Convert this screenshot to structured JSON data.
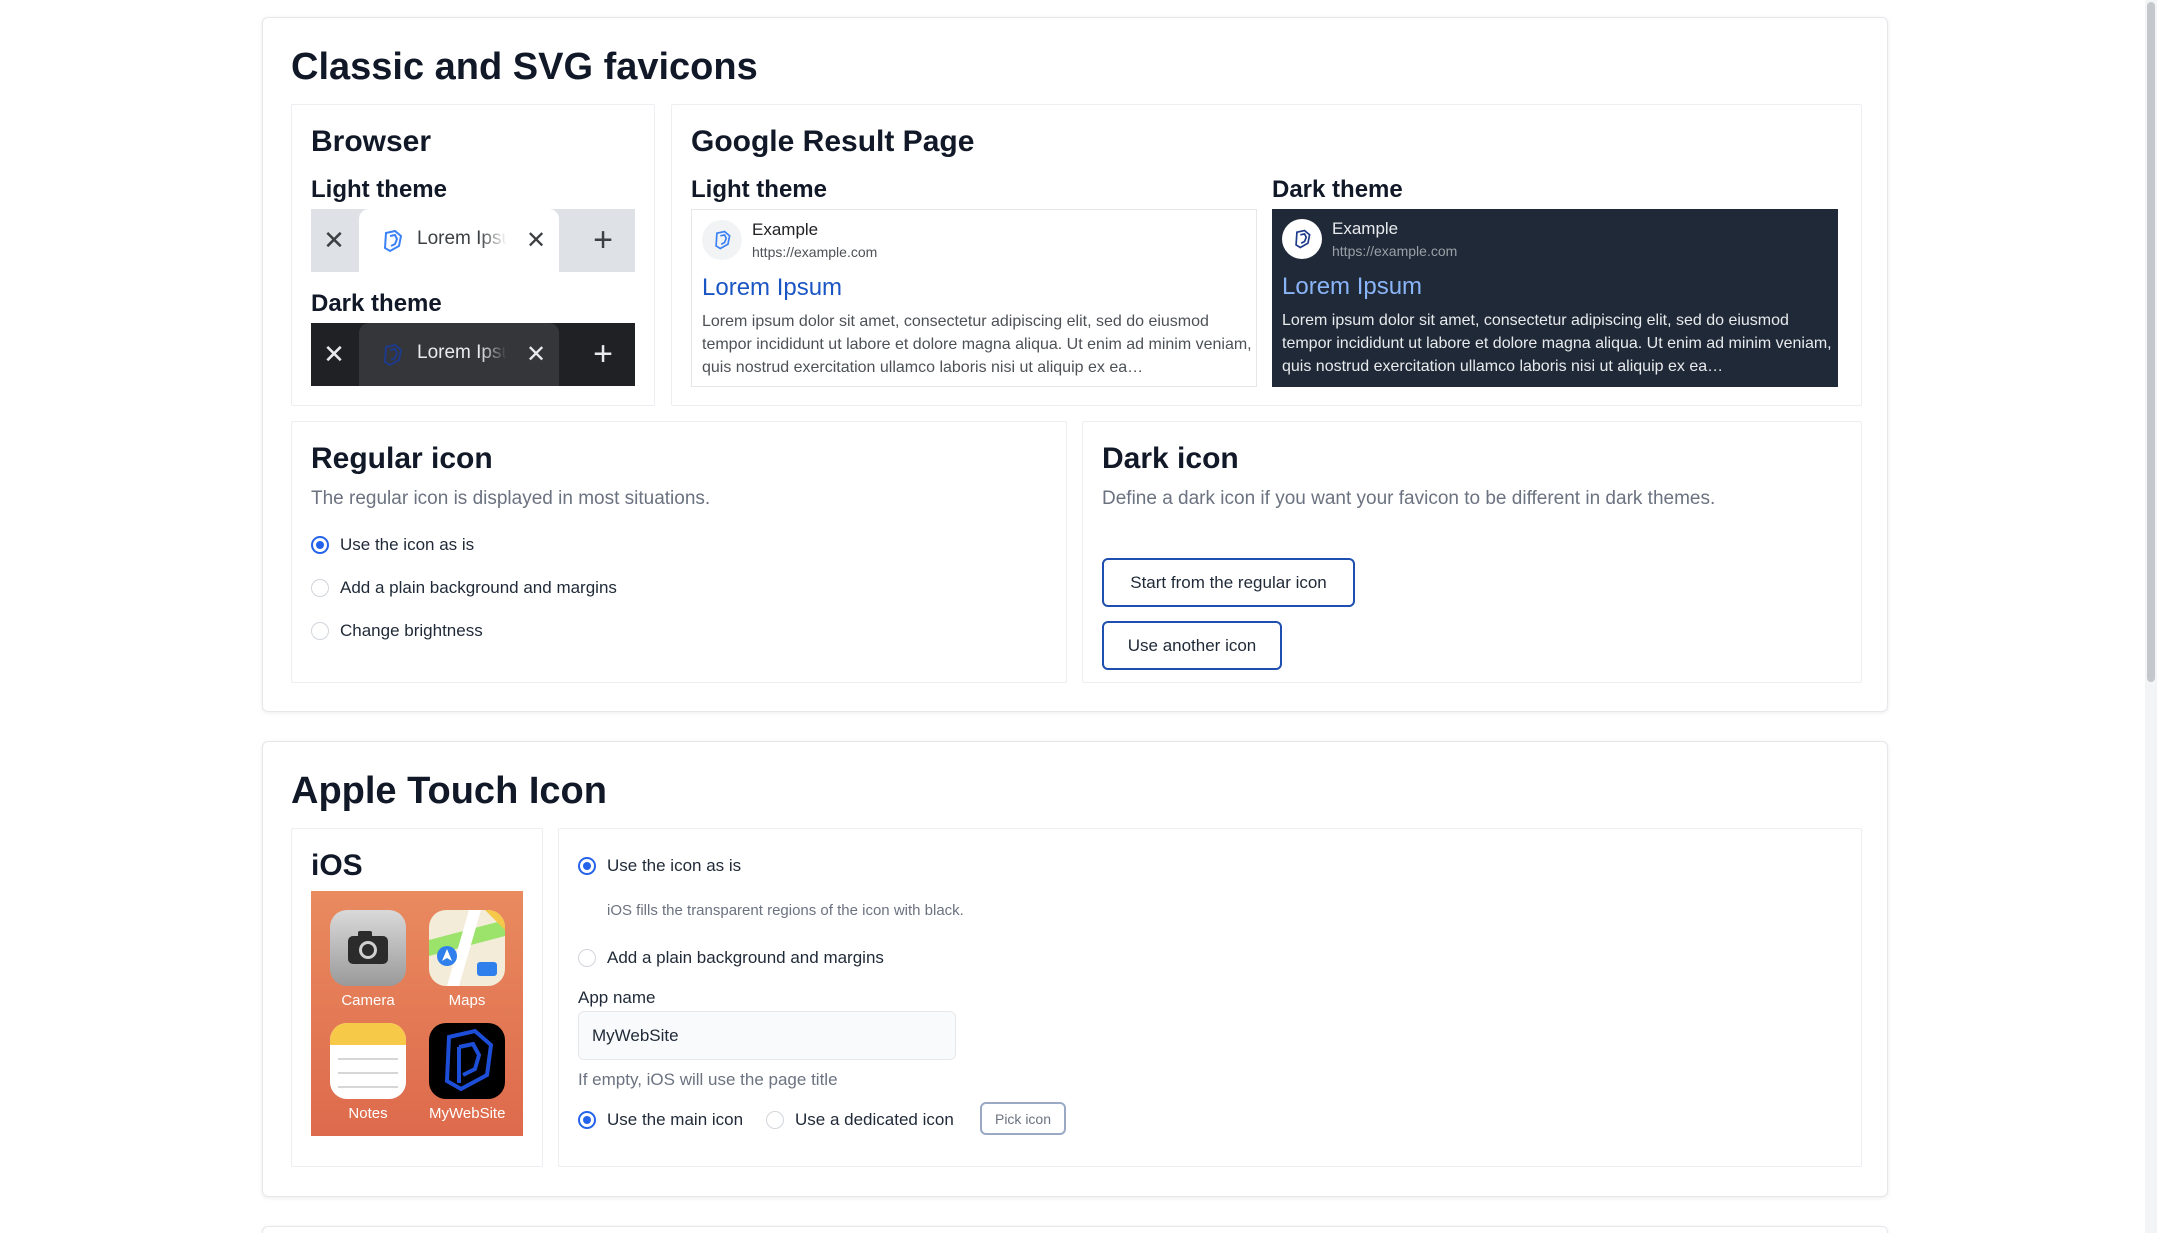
{
  "classic": {
    "title": "Classic and SVG favicons",
    "browser": {
      "title": "Browser",
      "light_label": "Light theme",
      "dark_label": "Dark theme",
      "tab_title": "Lorem Ipsum",
      "close_glyph": "✕",
      "plus_glyph": "+"
    },
    "google": {
      "title": "Google Result Page",
      "light_label": "Light theme",
      "dark_label": "Dark theme",
      "site_name": "Example",
      "site_url": "https://example.com",
      "result_title": "Lorem Ipsum",
      "snippet": "Lorem ipsum dolor sit amet, consectetur adipiscing elit, sed do eiusmod tempor incididunt ut labore et dolore magna aliqua. Ut enim ad minim veniam, quis nostrud exercitation ullamco laboris nisi ut aliquip ex ea…"
    },
    "regular": {
      "title": "Regular icon",
      "description": "The regular icon is displayed in most situations.",
      "options": [
        "Use the icon as is",
        "Add a plain background and margins",
        "Change brightness"
      ],
      "selected": 0
    },
    "dark": {
      "title": "Dark icon",
      "description": "Define a dark icon if you want your favicon to be different in dark themes.",
      "start_button": "Start from the regular icon",
      "another_button": "Use another icon"
    }
  },
  "apple": {
    "title": "Apple Touch Icon",
    "ios": {
      "title": "iOS",
      "apps": [
        "Camera",
        "Maps",
        "Notes",
        "MyWebSite"
      ]
    },
    "options": {
      "as_is": "Use the icon as is",
      "as_is_hint": "iOS fills the transparent regions of the icon with black.",
      "background": "Add a plain background and margins"
    },
    "app_name_label": "App name",
    "app_name_value": "MyWebSite",
    "app_name_hint": "If empty, iOS will use the page title",
    "main_icon": "Use the main icon",
    "dedicated_icon": "Use a dedicated icon",
    "pick_icon": "Pick icon"
  },
  "colors": {
    "accent": "#2563eb",
    "button_border": "#1e4fb0",
    "serp_dark_bg": "#1f2937",
    "brand_icon": "#1d4ed8"
  }
}
